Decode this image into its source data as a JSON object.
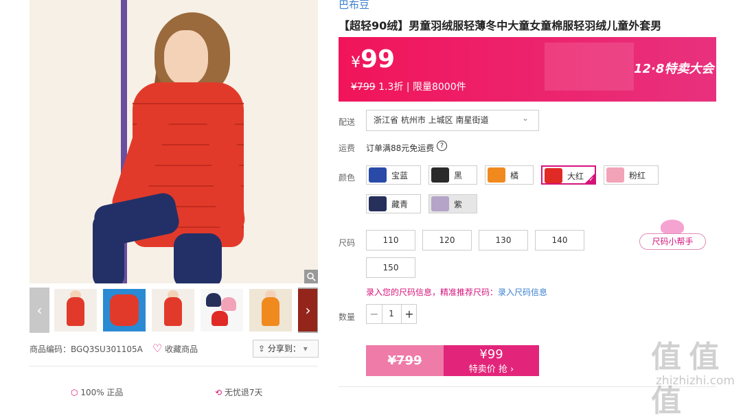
{
  "product": {
    "brand": "巴布豆",
    "title": "【超轻90绒】男童羽绒服轻薄冬中大童女童棉服轻羽绒儿童外套男",
    "code_label": "商品编码：",
    "code": "BGQ3SU301105A",
    "favorite_label": "收藏商品",
    "share_label": "分享到：",
    "share_arrow": "▾",
    "zoom_icon": "magnifier-icon"
  },
  "price": {
    "currency": "¥",
    "current": "99",
    "original": "¥799",
    "discount": "1.3折 | 限量8000件",
    "event_name": "12·8特卖大会",
    "accent": "#f1145a"
  },
  "delivery": {
    "label": "配送",
    "address": "浙江省 杭州市 上城区 南星街道",
    "dropdown_icon": "⌄"
  },
  "shipping": {
    "label": "运费",
    "text": "订单满88元免运费",
    "help_icon": "?"
  },
  "color": {
    "label": "颜色",
    "options": [
      {
        "name": "宝蓝",
        "swatch": "#2a4aa8"
      },
      {
        "name": "黑",
        "swatch": "#2a2a2a"
      },
      {
        "name": "橘",
        "swatch": "#f08a1f"
      },
      {
        "name": "大红",
        "swatch": "#e02a25"
      },
      {
        "name": "粉红",
        "swatch": "#f2a3b8"
      },
      {
        "name": "藏青",
        "swatch": "#27305a"
      },
      {
        "name": "紫",
        "swatch": "#b5a4c8"
      }
    ],
    "selected": "大红"
  },
  "size": {
    "label": "尺码",
    "options": [
      "110",
      "120",
      "130",
      "140",
      "150"
    ],
    "helper": "尺码小帮手",
    "tip_text": "录入您的尺码信息，精准推荐尺码：",
    "tip_link": "录入尺码信息"
  },
  "quantity": {
    "label": "数量",
    "value": "1",
    "minus": "−",
    "plus": "+"
  },
  "buy": {
    "original": "¥799",
    "price": "¥99",
    "label": "特卖价 抢 ›"
  },
  "bottom": {
    "feature1": "100% 正品",
    "feature2": "无忧退7天"
  },
  "watermark": "值 值 值",
  "watermark_url": "zhizhizhi.com",
  "thumb_arrows": {
    "left": "‹",
    "right": "›"
  }
}
